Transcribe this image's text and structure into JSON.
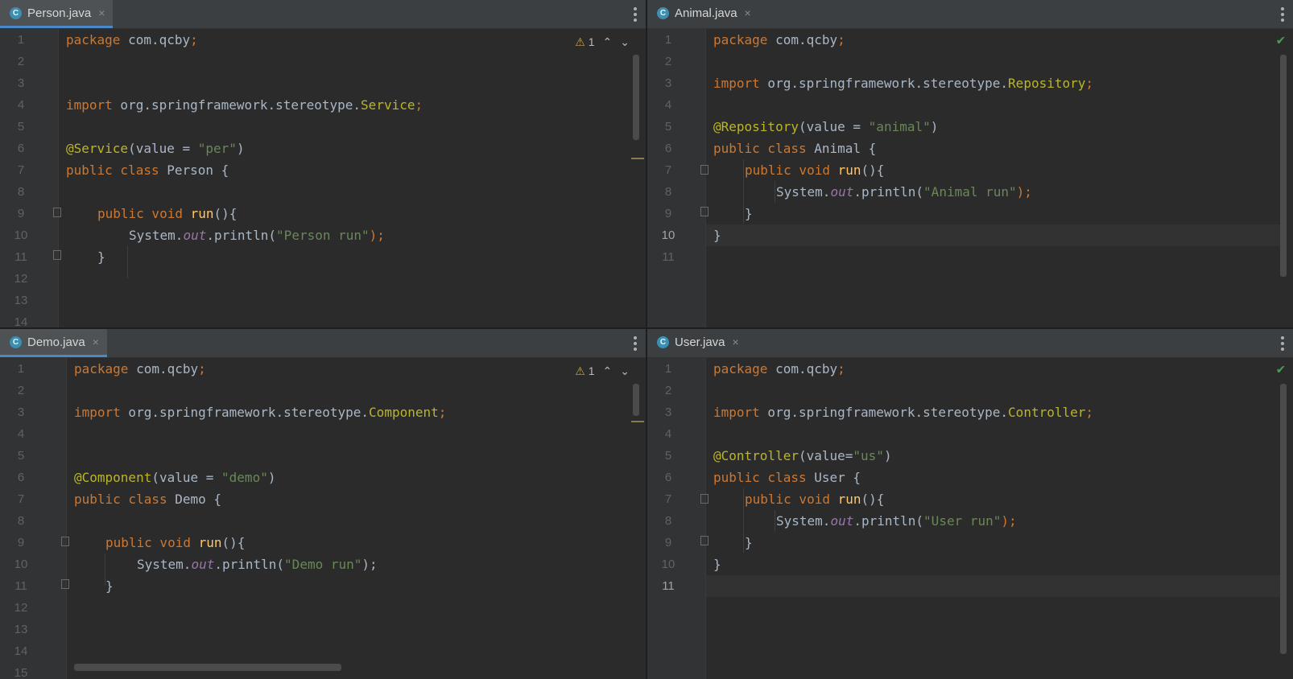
{
  "panes": {
    "tl": {
      "tab": {
        "icon": "C",
        "label": "Person.java",
        "close": "×"
      },
      "inspection": {
        "icon": "⚠",
        "count": "1",
        "up": "⌃",
        "down": "⌄"
      },
      "lines": [
        "1",
        "2",
        "3",
        "4",
        "5",
        "6",
        "7",
        "8",
        "9",
        "10",
        "11",
        "12",
        "13",
        "14"
      ],
      "code": {
        "l1_kw": "package",
        "l1_rest": " com.qcby",
        "l1_semi": ";",
        "l4_kw": "import",
        "l4_pkg": " org.springframework.stereotype.",
        "l4_cls": "Service",
        "l4_semi": ";",
        "l6_an": "@Service",
        "l6_a": "(value = ",
        "l6_str": "\"per\"",
        "l6_b": ")",
        "l7_kw": "public class",
        "l7_rest": " Person {",
        "l9_kw": "public void",
        "l9_m": " run",
        "l9_rest": "(){",
        "l10_a": "System.",
        "l10_it": "out",
        "l10_b": ".println(",
        "l10_str": "\"Person run\"",
        "l10_c": ");",
        "l11": "}"
      }
    },
    "tr": {
      "tab": {
        "icon": "C",
        "label": "Animal.java",
        "close": "×"
      },
      "check": "✔",
      "lines": [
        "1",
        "2",
        "3",
        "4",
        "5",
        "6",
        "7",
        "8",
        "9",
        "10",
        "11"
      ],
      "code": {
        "l1_kw": "package",
        "l1_rest": " com.qcby",
        "l1_semi": ";",
        "l3_kw": "import",
        "l3_pkg": " org.springframework.stereotype.",
        "l3_cls": "Repository",
        "l3_semi": ";",
        "l5_an": "@Repository",
        "l5_a": "(value = ",
        "l5_str": "\"animal\"",
        "l5_b": ")",
        "l6_kw": "public class",
        "l6_rest": " Animal {",
        "l7_kw": "public void",
        "l7_m": " run",
        "l7_rest": "(){",
        "l8_a": "System.",
        "l8_it": "out",
        "l8_b": ".println(",
        "l8_str": "\"Animal run\"",
        "l8_c": ");",
        "l9": "}",
        "l10": "}"
      }
    },
    "bl": {
      "tab": {
        "icon": "C",
        "label": "Demo.java",
        "close": "×"
      },
      "inspection": {
        "icon": "⚠",
        "count": "1",
        "up": "⌃",
        "down": "⌄"
      },
      "lines": [
        "1",
        "2",
        "3",
        "4",
        "5",
        "6",
        "7",
        "8",
        "9",
        "10",
        "11",
        "12",
        "13",
        "14",
        "15"
      ],
      "code": {
        "l1_kw": "package",
        "l1_rest": " com.qcby",
        "l1_semi": ";",
        "l3_kw": "import",
        "l3_pkg": " org.springframework.stereotype.",
        "l3_cls": "Component",
        "l3_semi": ";",
        "l6_an": "@Component",
        "l6_a": "(value = ",
        "l6_str": "\"demo\"",
        "l6_b": ")",
        "l7_kw": "public class",
        "l7_rest": " Demo {",
        "l9_kw": "public void",
        "l9_m": " run",
        "l9_rest": "(){",
        "l10_a": "System.",
        "l10_it": "out",
        "l10_b": ".println(",
        "l10_str": "\"Demo run\"",
        "l10_c": ");",
        "l11": "}"
      }
    },
    "br": {
      "tab": {
        "icon": "C",
        "label": "User.java",
        "close": "×"
      },
      "check": "✔",
      "lines": [
        "1",
        "2",
        "3",
        "4",
        "5",
        "6",
        "7",
        "8",
        "9",
        "10",
        "11"
      ],
      "code": {
        "l1_kw": "package",
        "l1_rest": " com.qcby",
        "l1_semi": ";",
        "l3_kw": "import",
        "l3_pkg": " org.springframework.stereotype.",
        "l3_cls": "Controller",
        "l3_semi": ";",
        "l5_an": "@Controller",
        "l5_a": "(value=",
        "l5_str": "\"us\"",
        "l5_b": ")",
        "l6_kw": "public class",
        "l6_rest": " User {",
        "l7_kw": "public void",
        "l7_m": " run",
        "l7_rest": "(){",
        "l8_a": "System.",
        "l8_it": "out",
        "l8_b": ".println(",
        "l8_str": "\"User run\"",
        "l8_c": ");",
        "l9": "}",
        "l10": "}"
      }
    }
  },
  "colors": {
    "keyword": "#cc7832",
    "annotation": "#bbb529",
    "string": "#6a8759",
    "field": "#9876aa",
    "text": "#a9b7c6"
  }
}
